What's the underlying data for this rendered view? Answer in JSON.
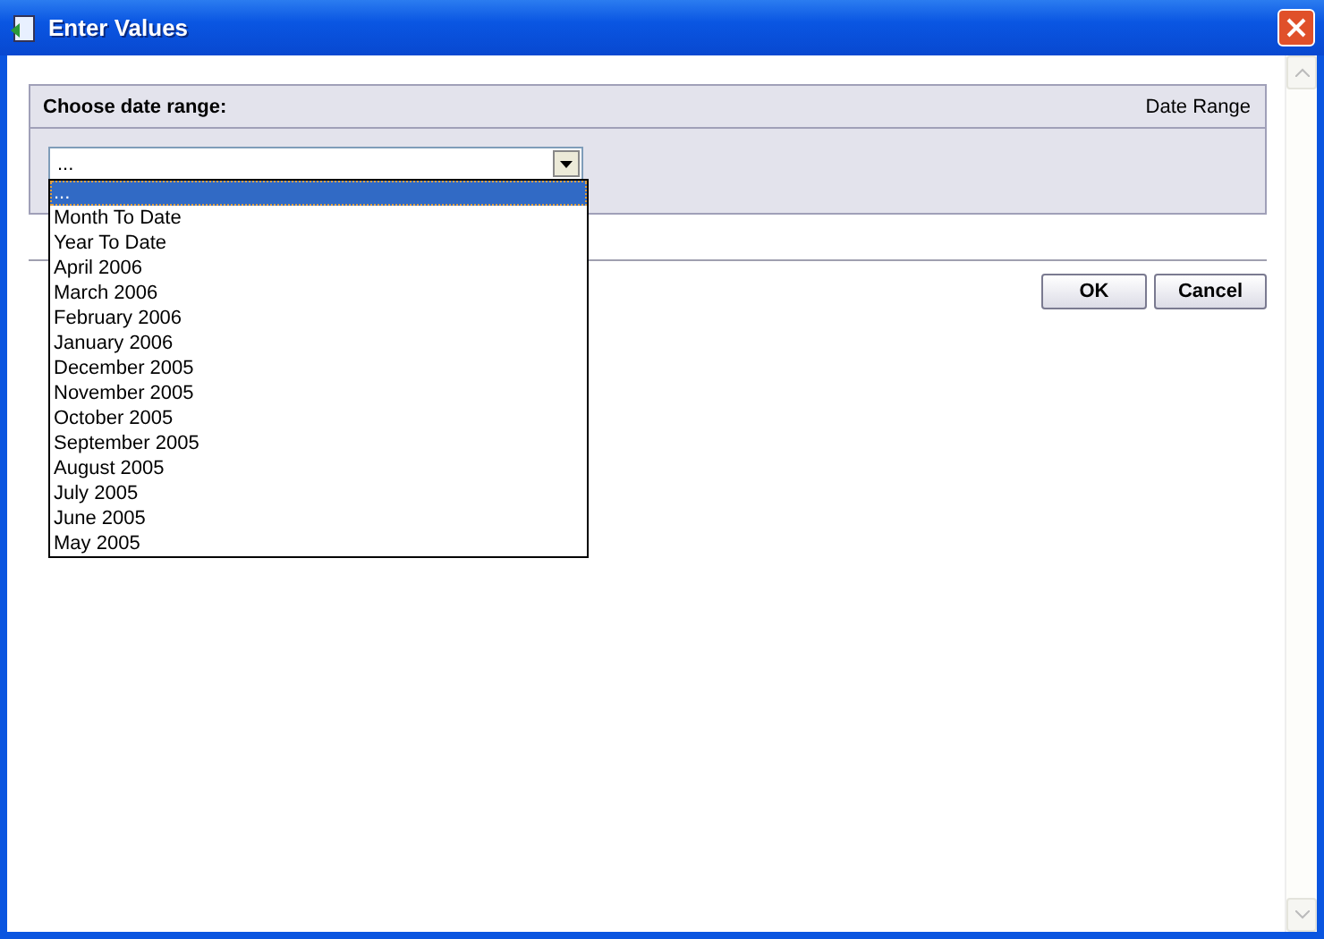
{
  "window": {
    "title": "Enter Values"
  },
  "panel": {
    "title": "Choose date range:",
    "label": "Date Range"
  },
  "select": {
    "value": "...",
    "expanded": true,
    "options": [
      {
        "label": "...",
        "selected": true
      },
      {
        "label": "Month To Date",
        "selected": false
      },
      {
        "label": "Year To Date",
        "selected": false
      },
      {
        "label": "April 2006",
        "selected": false
      },
      {
        "label": "March 2006",
        "selected": false
      },
      {
        "label": "February 2006",
        "selected": false
      },
      {
        "label": "January 2006",
        "selected": false
      },
      {
        "label": "December 2005",
        "selected": false
      },
      {
        "label": "November 2005",
        "selected": false
      },
      {
        "label": "October 2005",
        "selected": false
      },
      {
        "label": "September 2005",
        "selected": false
      },
      {
        "label": "August 2005",
        "selected": false
      },
      {
        "label": "July 2005",
        "selected": false
      },
      {
        "label": "June 2005",
        "selected": false
      },
      {
        "label": "May 2005",
        "selected": false
      }
    ]
  },
  "buttons": [
    "OK",
    "Cancel"
  ]
}
